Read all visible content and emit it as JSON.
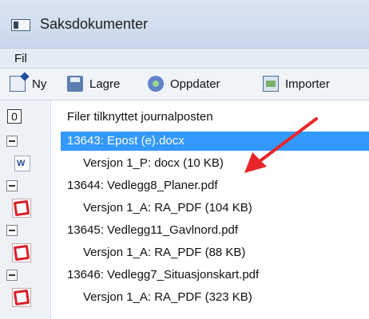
{
  "window": {
    "title": "Saksdokumenter",
    "icon": "window-icon"
  },
  "menu": {
    "items": [
      {
        "label": "Fil"
      }
    ]
  },
  "toolbar": {
    "buttons": [
      {
        "label": "Ny",
        "icon": "new-document-icon"
      },
      {
        "label": "Lagre",
        "icon": "save-icon"
      },
      {
        "label": "Oppdater",
        "icon": "refresh-icon"
      },
      {
        "label": "Importer",
        "icon": "import-icon"
      }
    ]
  },
  "tree": {
    "header": {
      "count": "0",
      "label": "Filer tilknyttet journalposten"
    },
    "items": [
      {
        "label": "13643: Epost (e).docx",
        "version": "Versjon 1_P: docx (10 KB)",
        "type": "word",
        "selected": true
      },
      {
        "label": "13644: Vedlegg8_Planer.pdf",
        "version": "Versjon 1_A: RA_PDF (104 KB)",
        "type": "pdf"
      },
      {
        "label": "13645: Vedlegg11_Gavlnord.pdf",
        "version": "Versjon 1_A: RA_PDF (88 KB)",
        "type": "pdf"
      },
      {
        "label": "13646: Vedlegg7_Situasjonskart.pdf",
        "version": "Versjon 1_A: RA_PDF (323 KB)",
        "type": "pdf"
      }
    ]
  },
  "icons": {
    "word": "W"
  },
  "colors": {
    "selection": "#3399ff",
    "annotation_arrow": "#e8262a"
  }
}
